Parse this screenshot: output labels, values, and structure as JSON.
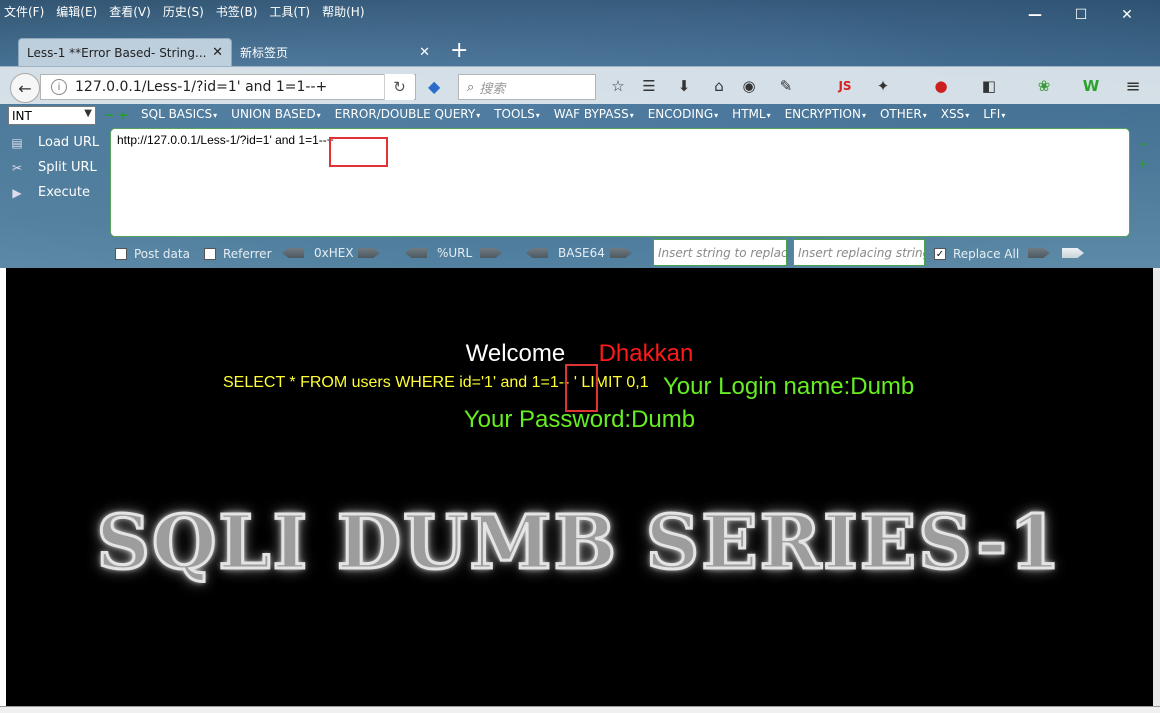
{
  "menubar": [
    "文件(F)",
    "编辑(E)",
    "查看(V)",
    "历史(S)",
    "书签(B)",
    "工具(T)",
    "帮助(H)"
  ],
  "window_controls": {
    "minimize": "—",
    "maximize": "☐",
    "close": "✕"
  },
  "tabs": [
    {
      "title": "Less-1 **Error Based- String...",
      "close": "✕"
    },
    {
      "title": "新标签页",
      "close": "✕"
    }
  ],
  "new_tab": "+",
  "navbar": {
    "url": "127.0.0.1/Less-1/?id=1'  and 1=1--+",
    "search_placeholder": "搜索",
    "js_label": "JS"
  },
  "hackbar": {
    "select_value": "INT",
    "menu": [
      "SQL BASICS",
      "UNION BASED",
      "ERROR/DOUBLE QUERY",
      "TOOLS",
      "WAF BYPASS",
      "ENCODING",
      "HTML",
      "ENCRYPTION",
      "OTHER",
      "XSS",
      "LFI"
    ],
    "side": [
      "Load URL",
      "Split URL",
      "Execute"
    ],
    "textarea": "http://127.0.0.1/Less-1/?id=1'  and 1=1--+",
    "post_data": "Post data",
    "referrer": "Referrer",
    "hex": "0xHEX",
    "url_enc": "%URL",
    "base64": "BASE64",
    "replace_placeholder": "Insert string to replace",
    "replacing_placeholder": "Insert replacing string",
    "replace_all": "Replace All"
  },
  "content": {
    "welcome": "Welcome",
    "user": "Dhakkan",
    "query": "SELECT * FROM users WHERE id='1' and 1=1-- ' LIMIT 0,1",
    "login_name": "Your Login name:Dumb",
    "password": "Your Password:Dumb",
    "banner": "SQLI DUMB SERIES-1"
  },
  "colors": {
    "highlight_box": "#e03333",
    "query_text": "#ffff33",
    "result_text": "#66ee22",
    "user_text": "#ff1a1a"
  }
}
